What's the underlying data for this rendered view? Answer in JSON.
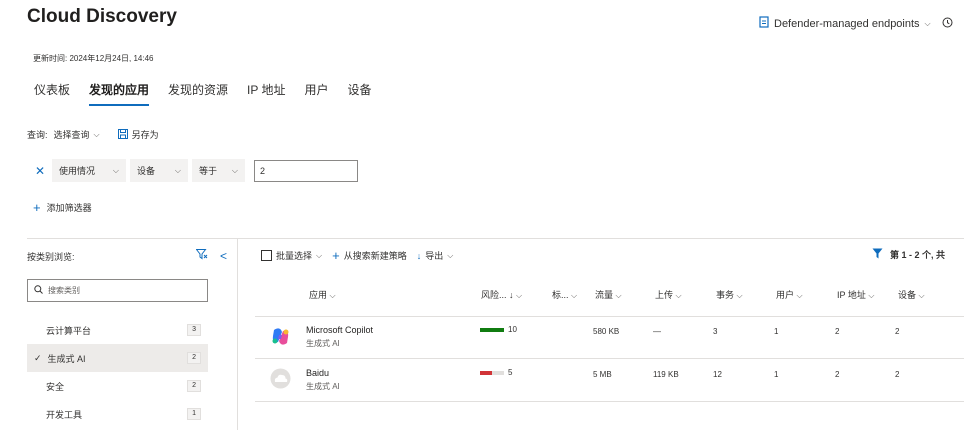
{
  "header": {
    "title": "Cloud Discovery",
    "endpoint_label": "Defender-managed endpoints",
    "updated": "更新时间: 2024年12月24日, 14:46"
  },
  "tabs": [
    {
      "label": "仪表板"
    },
    {
      "label": "发现的应用"
    },
    {
      "label": "发现的资源"
    },
    {
      "label": "IP 地址"
    },
    {
      "label": "用户"
    },
    {
      "label": "设备"
    }
  ],
  "query": {
    "label": "查询:",
    "select_label": "选择查询",
    "save_as": "另存为"
  },
  "filter": {
    "field": "使用情况",
    "entity": "设备",
    "operator": "等于",
    "value": "2",
    "add_filter": "添加筛选器"
  },
  "sidebar": {
    "title": "按类别浏览:",
    "search_placeholder": "搜索类别",
    "categories": [
      {
        "label": "云计算平台",
        "count": "3"
      },
      {
        "label": "生成式 AI",
        "count": "2"
      },
      {
        "label": "安全",
        "count": "2"
      },
      {
        "label": "开发工具",
        "count": "1"
      }
    ]
  },
  "toolbar": {
    "bulk_select": "批量选择",
    "new_policy": "从搜索新建策略",
    "export": "导出",
    "range": "第 1 - 2 个, 共"
  },
  "table": {
    "columns": {
      "app": "应用",
      "risk": "风险...",
      "tag": "标...",
      "traffic": "流量",
      "upload": "上传",
      "transactions": "事务",
      "users": "用户",
      "ip": "IP 地址",
      "devices": "设备"
    },
    "rows": [
      {
        "name": "Microsoft Copilot",
        "category": "生成式 AI",
        "risk_score": "10",
        "traffic": "580 KB",
        "upload": "—",
        "transactions": "3",
        "users": "1",
        "ip": "2",
        "devices": "2"
      },
      {
        "name": "Baidu",
        "category": "生成式 AI",
        "risk_score": "5",
        "traffic": "5 MB",
        "upload": "119 KB",
        "transactions": "12",
        "users": "1",
        "ip": "2",
        "devices": "2"
      }
    ]
  },
  "colors": {
    "accent": "#0f6cbd",
    "risk_high": "#107c10",
    "risk_low": "#d13438"
  }
}
